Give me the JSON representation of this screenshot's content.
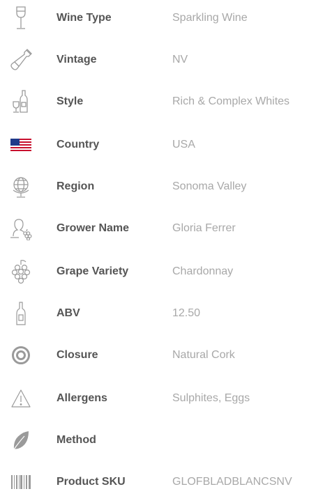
{
  "specs": [
    {
      "icon": "wine-glass-icon",
      "label": "Wine Type",
      "value": "Sparkling Wine"
    },
    {
      "icon": "wine-bottle-icon",
      "label": "Vintage",
      "value": "NV"
    },
    {
      "icon": "bottle-and-glass-icon",
      "label": "Style",
      "value": "Rich & Complex Whites"
    },
    {
      "icon": "usa-flag-icon",
      "label": "Country",
      "value": "USA"
    },
    {
      "icon": "globe-icon",
      "label": "Region",
      "value": "Sonoma Valley"
    },
    {
      "icon": "grower-icon",
      "label": "Grower Name",
      "value": "Gloria Ferrer"
    },
    {
      "icon": "grapes-icon",
      "label": "Grape Variety",
      "value": "Chardonnay"
    },
    {
      "icon": "bottle-icon",
      "label": "ABV",
      "value": "12.50"
    },
    {
      "icon": "target-icon",
      "label": "Closure",
      "value": "Natural Cork"
    },
    {
      "icon": "warning-icon",
      "label": "Allergens",
      "value": "Sulphites, Eggs"
    },
    {
      "icon": "leaf-icon",
      "label": "Method",
      "value": ""
    },
    {
      "icon": "barcode-icon",
      "label": "Product SKU",
      "value": "GLOFBLADBLANCSNV"
    }
  ],
  "colors": {
    "label": "#555555",
    "value": "#a8a8a8",
    "icon": "#9a9a9a"
  }
}
